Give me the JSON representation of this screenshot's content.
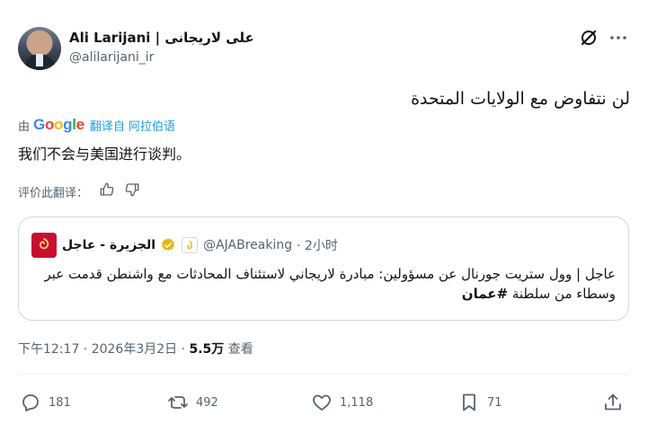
{
  "author": {
    "display_name": "Ali Larijani | علی لاریجانی",
    "handle": "@alilarijani_ir"
  },
  "tweet": {
    "text": "لن نتفاوض مع الولايات المتحدة",
    "by_prefix": "由",
    "google_label": "Google",
    "translate_label": "翻译自 阿拉伯语",
    "translated_text": "我们不会与美国进行谈判。",
    "rate_label": "评价此翻译："
  },
  "quote": {
    "name": "الجزيرة - عاجل",
    "handle": "@AJABreaking",
    "time": "· 2小时",
    "text": "عاجل | وول ستريت جورنال عن مسؤولين: مبادرة لاريجاني لاستئناف المحادثات مع واشنطن قدمت عبر وسطاء من سلطنة ",
    "hashtag": "#عمان"
  },
  "meta": {
    "time": "下午12:17 · 2026年3月2日 · ",
    "views": "5.5万",
    "views_label": " 查看"
  },
  "actions": {
    "replies": "181",
    "retweets": "492",
    "likes": "1,118",
    "bookmarks": "71"
  },
  "colors": {
    "accent": "#1d9bf0",
    "secondary_text": "#536471",
    "aljazeera_red": "#c8102e",
    "verified_gold": "#e2b719"
  },
  "icons": [
    "grok-icon",
    "more-icon",
    "thumbs-up-icon",
    "thumbs-down-icon",
    "verified-icon",
    "reply-icon",
    "retweet-icon",
    "like-icon",
    "bookmark-icon",
    "share-icon"
  ]
}
